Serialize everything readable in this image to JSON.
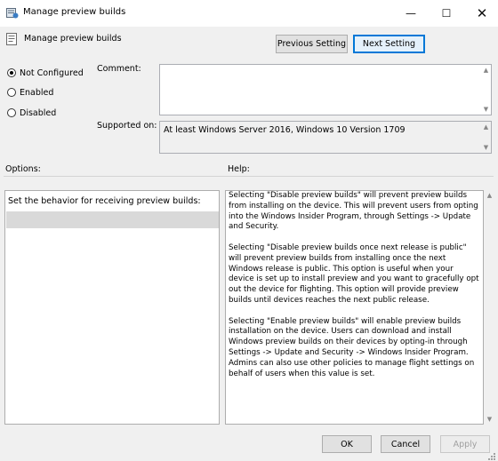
{
  "window": {
    "title": "Manage preview builds",
    "minimize_glyph": "—",
    "maximize_glyph": "☐",
    "close_glyph": "✕"
  },
  "header": {
    "title": "Manage preview builds"
  },
  "nav": {
    "previous_label": "Previous Setting",
    "next_label": "Next Setting"
  },
  "state": {
    "options": [
      {
        "label": "Not Configured",
        "checked": true
      },
      {
        "label": "Enabled",
        "checked": false
      },
      {
        "label": "Disabled",
        "checked": false
      }
    ]
  },
  "comment": {
    "label": "Comment:",
    "value": ""
  },
  "supported": {
    "label": "Supported on:",
    "value": "At least Windows Server 2016, Windows 10 Version 1709"
  },
  "sections": {
    "options_label": "Options:",
    "help_label": "Help:"
  },
  "options_pane": {
    "text": "Set the behavior for receiving preview builds:"
  },
  "help_pane": {
    "text": "Selecting \"Disable preview builds\" will prevent preview builds from installing on the device. This will prevent users from opting into the Windows Insider Program, through Settings -> Update and Security.\n\nSelecting \"Disable preview builds once next release is public\" will prevent preview builds from installing once the next Windows release is public. This option is useful when your device is set up to install preview and you want to gracefully opt out the device for flighting. This option will provide preview builds until devices reaches the next public release.\n\nSelecting \"Enable preview builds\" will enable preview builds installation on the device. Users can download and install Windows preview builds on their devices by opting-in through Settings -> Update and Security -> Windows Insider Program. Admins can also use other policies to manage flight settings on behalf of users when this value is set."
  },
  "footer": {
    "ok_label": "OK",
    "cancel_label": "Cancel",
    "apply_label": "Apply"
  },
  "icons": {
    "title": "policy-settings-icon",
    "header": "policy-document-icon"
  },
  "colors": {
    "accent": "#0078d7",
    "window_bg": "#f0f0f0",
    "selection": "#d9d9d9"
  }
}
